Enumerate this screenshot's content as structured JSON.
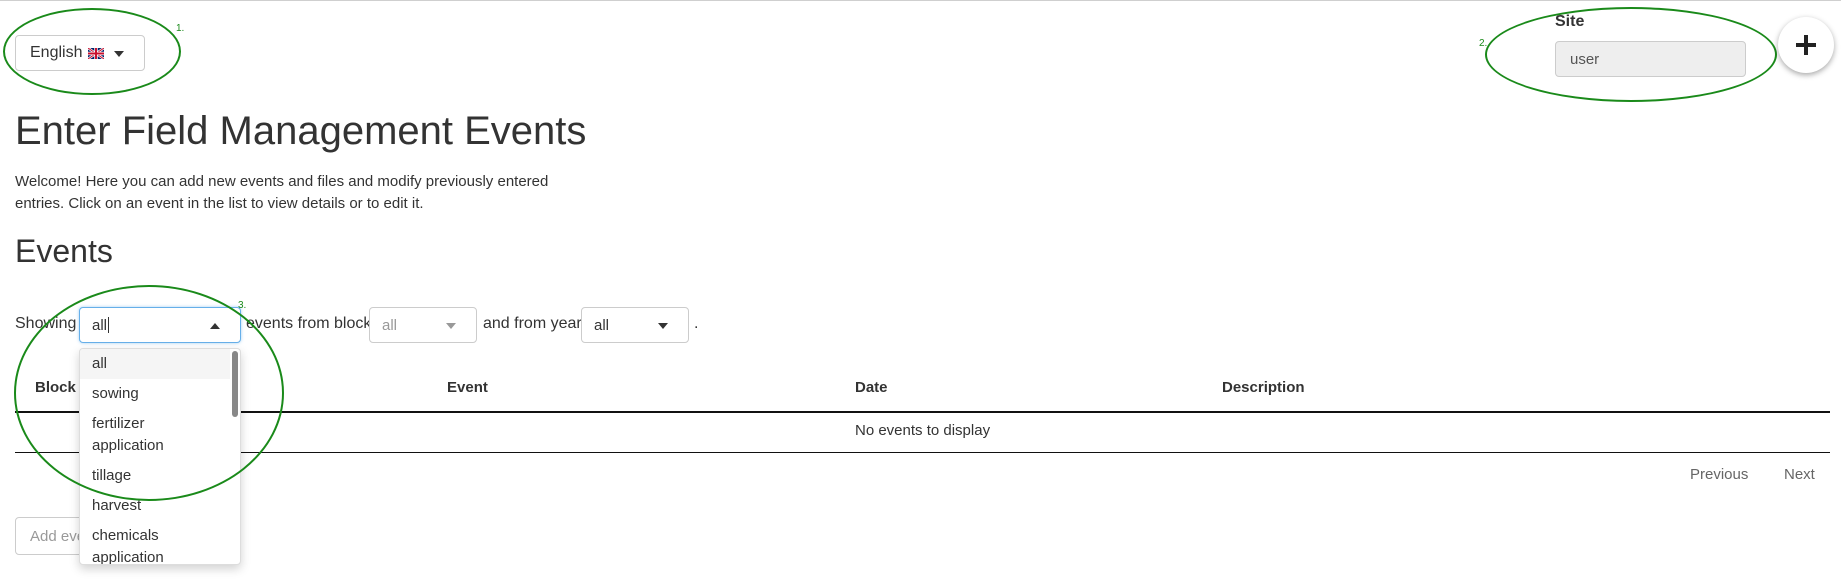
{
  "language": {
    "selected": "English",
    "flag_icon": "uk-flag-icon"
  },
  "site": {
    "label": "Site",
    "value": "user"
  },
  "add_button": {
    "label": "+"
  },
  "title": "Enter Field Management Events",
  "welcome": "Welcome! Here you can add new events and files and modify previously entered entries. Click on an event in the list to view details or to edit it.",
  "events_section": {
    "title": "Events",
    "filter": {
      "showing_label": "Showing",
      "event_type_value": "all",
      "from_block_label": "events from block",
      "block_value": "all",
      "from_year_label": "and from year",
      "year_value": "all",
      "period": "."
    },
    "event_type_options": [
      "all",
      "sowing",
      "fertilizer application",
      "tillage",
      "harvest",
      "chemicals application"
    ],
    "table": {
      "headers": [
        "Block",
        "Event",
        "Date",
        "Description"
      ],
      "empty_message": "No events to display"
    },
    "pagination": {
      "previous": "Previous",
      "next": "Next"
    },
    "add_event_label": "Add event"
  },
  "annotations": [
    "1.",
    "2.",
    "3."
  ],
  "colors": {
    "annotation": "#1a8a1a",
    "focus_border": "#66afe9"
  }
}
